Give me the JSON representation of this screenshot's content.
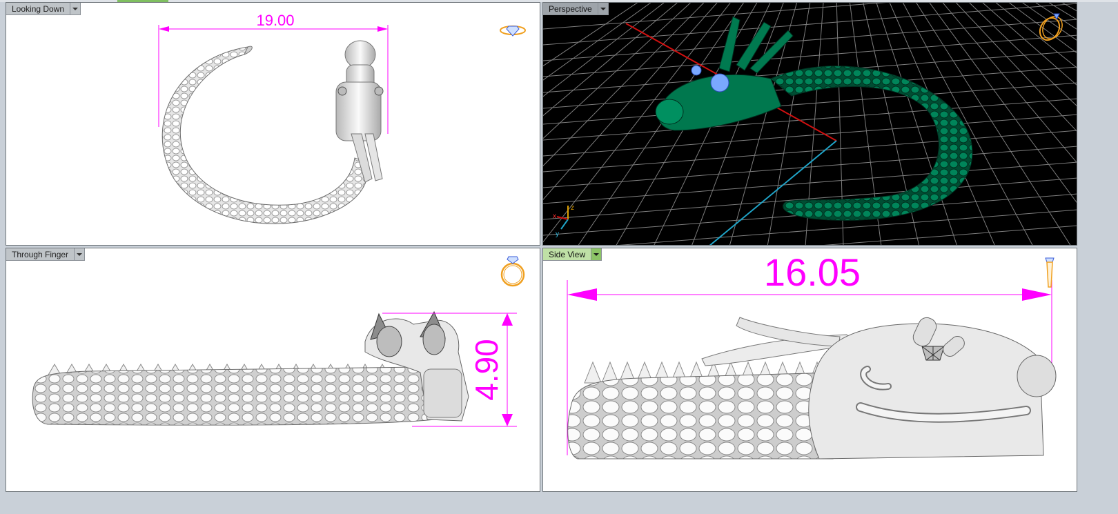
{
  "viewports": {
    "top": {
      "label": "Looking Down",
      "dimension": "19.00"
    },
    "perspective": {
      "label": "Perspective"
    },
    "front": {
      "label": "Through Finger",
      "dimension": "4.90"
    },
    "side": {
      "label": "Side View",
      "dimension": "16.05"
    }
  },
  "axes": {
    "x": "x",
    "y": "y",
    "z": "z"
  },
  "icons": {
    "dropdown": "chevron-down-icon",
    "ring_top": "ring-top-view-icon",
    "ring_perspective": "ring-perspective-icon",
    "ring_front": "ring-front-view-icon",
    "ring_side": "ring-side-view-icon"
  },
  "colors": {
    "dimension": "#ff00ff",
    "model_render": "#00704a",
    "grid": "#8a8a8a",
    "x_axis": "#d01010",
    "y_axis": "#1fa4c8",
    "active_tab": "#8cc466",
    "ring_icon": "#f0a020"
  }
}
